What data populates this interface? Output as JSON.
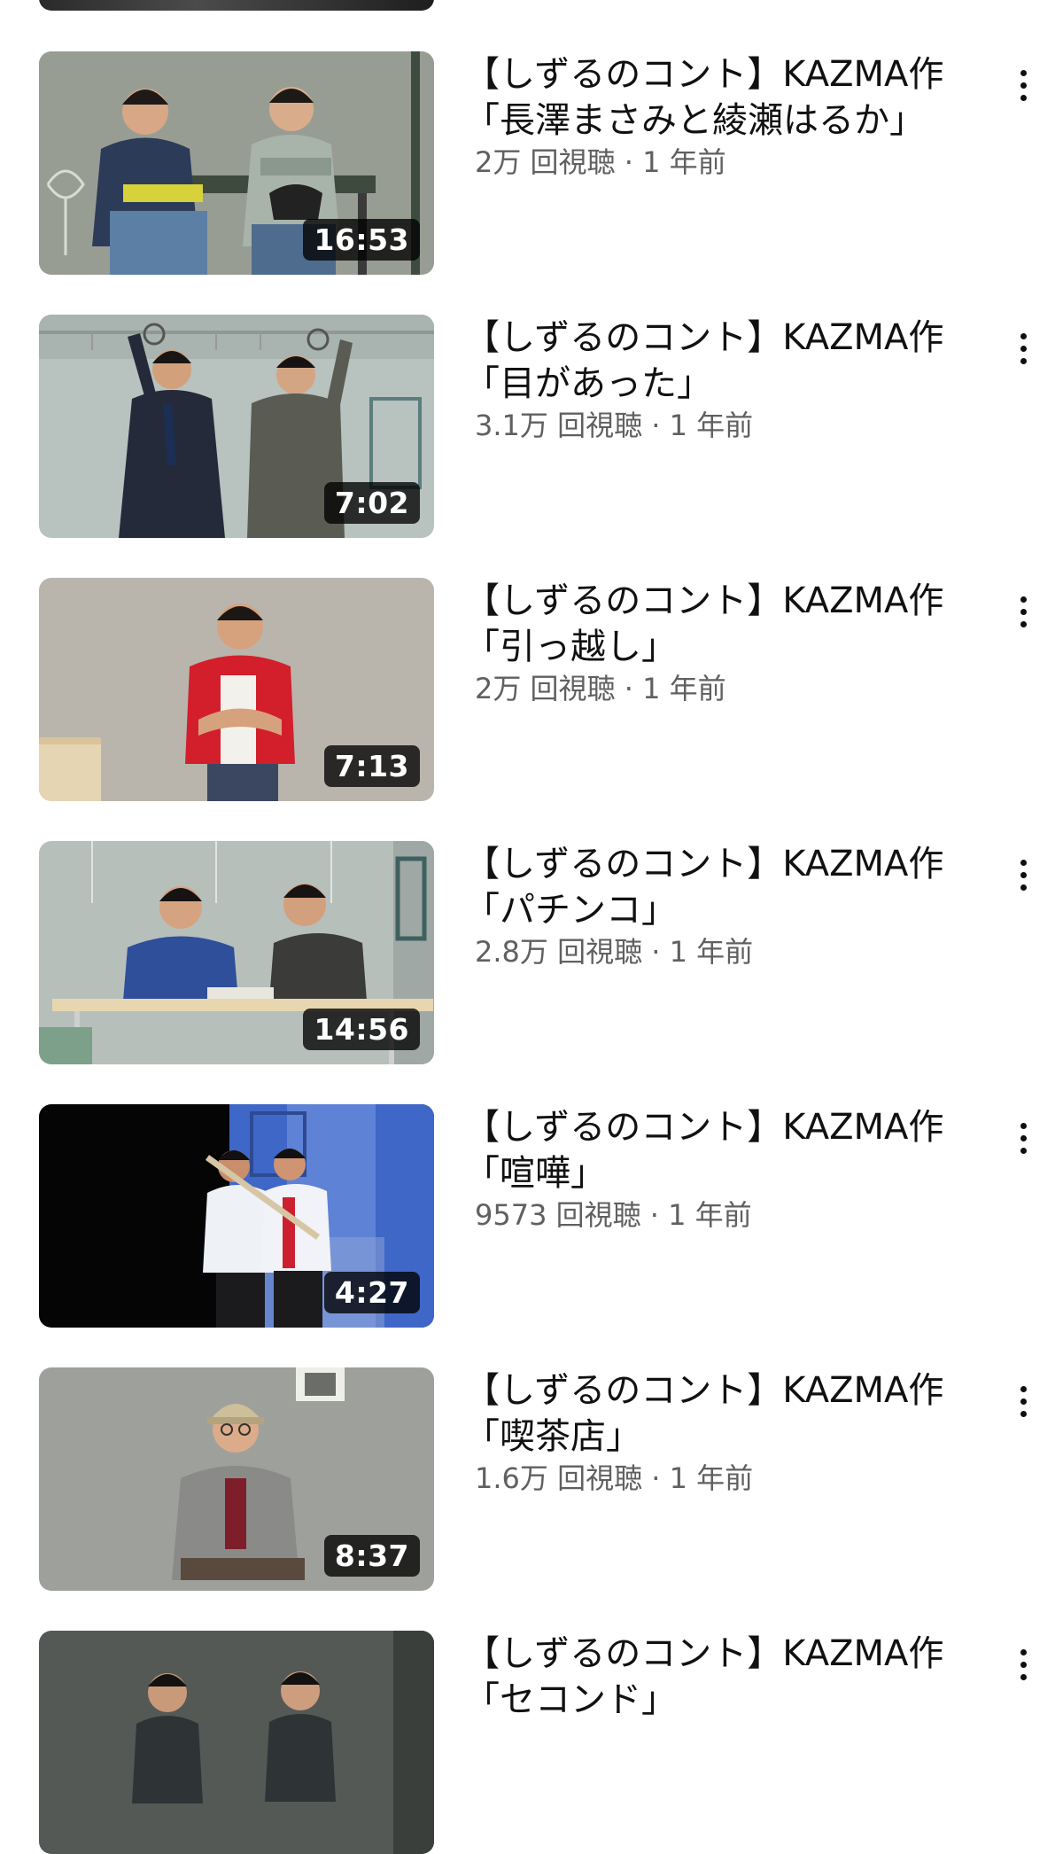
{
  "videos": [
    {
      "title_line1": "【しずるのコント】KAZMA作",
      "title_line2": "「長澤まさみと綾瀬はるか」",
      "views": "2万 回視聴",
      "age": "1 年前",
      "duration": "16:53",
      "thumbnail": "two-men-on-bench"
    },
    {
      "title_line1": "【しずるのコント】KAZMA作",
      "title_line2": "「目があった」",
      "views": "3.1万 回視聴",
      "age": "1 年前",
      "duration": "7:02",
      "thumbnail": "two-men-on-train"
    },
    {
      "title_line1": "【しずるのコント】KAZMA作",
      "title_line2": "「引っ越し」",
      "views": "2万 回視聴",
      "age": "1 年前",
      "duration": "7:13",
      "thumbnail": "man-in-red-shirt"
    },
    {
      "title_line1": "【しずるのコント】KAZMA作",
      "title_line2": "「パチンコ」",
      "views": "2.8万 回視聴",
      "age": "1 年前",
      "duration": "14:56",
      "thumbnail": "two-men-at-table"
    },
    {
      "title_line1": "【しずるのコント】KAZMA作",
      "title_line2": "「喧嘩」",
      "views": "9573 回視聴",
      "age": "1 年前",
      "duration": "4:27",
      "thumbnail": "two-men-fighting-blue-stage"
    },
    {
      "title_line1": "【しずるのコント】KAZMA作",
      "title_line2": "「喫茶店」",
      "views": "1.6万 回視聴",
      "age": "1 年前",
      "duration": "8:37",
      "thumbnail": "man-in-cap-at-table"
    },
    {
      "title_line1": "【しずるのコント】KAZMA作",
      "title_line2": "「セコンド」",
      "views": "",
      "age": "",
      "duration": "",
      "thumbnail": "two-men-dark-stage"
    }
  ],
  "separator": " · ",
  "colors": {
    "title": "#111111",
    "stats": "#606060",
    "duration_bg": "#000000",
    "duration_text": "#ffffff"
  },
  "icons": {
    "more": "more-vert-icon"
  }
}
